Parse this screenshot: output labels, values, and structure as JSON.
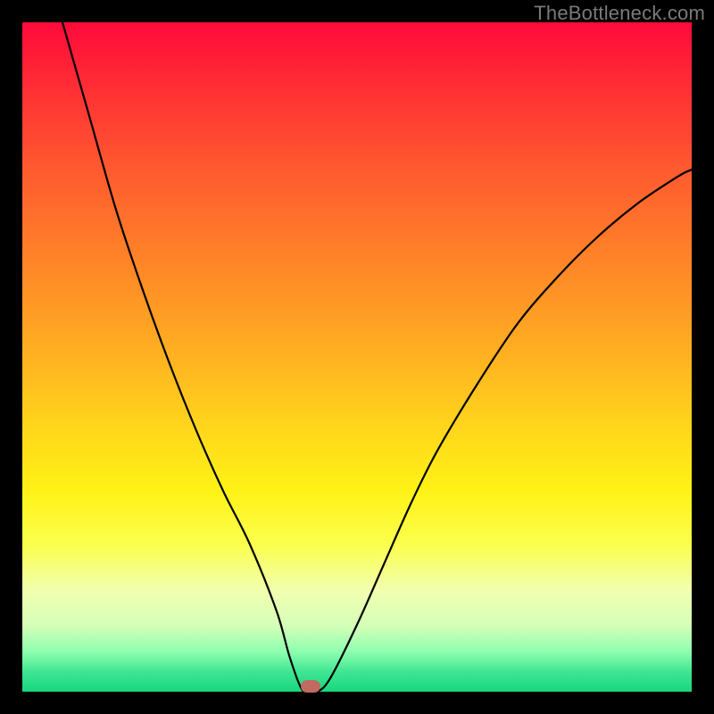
{
  "watermark": "TheBottleneck.com",
  "chart_data": {
    "type": "line",
    "title": "",
    "xlabel": "",
    "ylabel": "",
    "xlim": [
      0,
      100
    ],
    "ylim": [
      0,
      100
    ],
    "series": [
      {
        "name": "bottleneck-curve",
        "x": [
          6,
          10,
          14,
          18,
          22,
          26,
          30,
          34,
          38,
          40,
          42,
          44,
          46,
          50,
          54,
          58,
          62,
          68,
          74,
          80,
          86,
          92,
          98,
          100
        ],
        "y": [
          100,
          86,
          72,
          60,
          49,
          39,
          30,
          22,
          12,
          5,
          0,
          0,
          2,
          10,
          19,
          28,
          36,
          46,
          55,
          62,
          68,
          73,
          77,
          78
        ]
      }
    ],
    "marker": {
      "x": 43,
      "y": 0,
      "label": "optimal-point"
    },
    "background_gradient": {
      "top": "#ff0a3a",
      "mid": "#ffd41c",
      "bottom": "#18d67f"
    }
  }
}
